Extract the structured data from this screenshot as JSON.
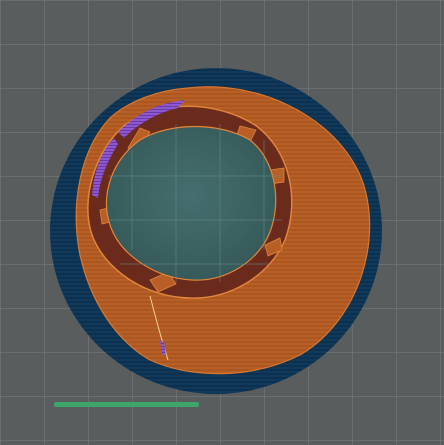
{
  "viewport": {
    "background_color": "#5a5d5e",
    "grid_color": "#7c7f80",
    "bed_grid": true
  },
  "model": {
    "shell_color": "#b35d25",
    "outer_skirt_color": "#0f3556",
    "inner_wall_color": "#7a2e1f",
    "support_color": "#8a55c8",
    "center_hole_color": "#3b6262"
  },
  "indicators": {
    "slider_color": "#3fa66b"
  }
}
